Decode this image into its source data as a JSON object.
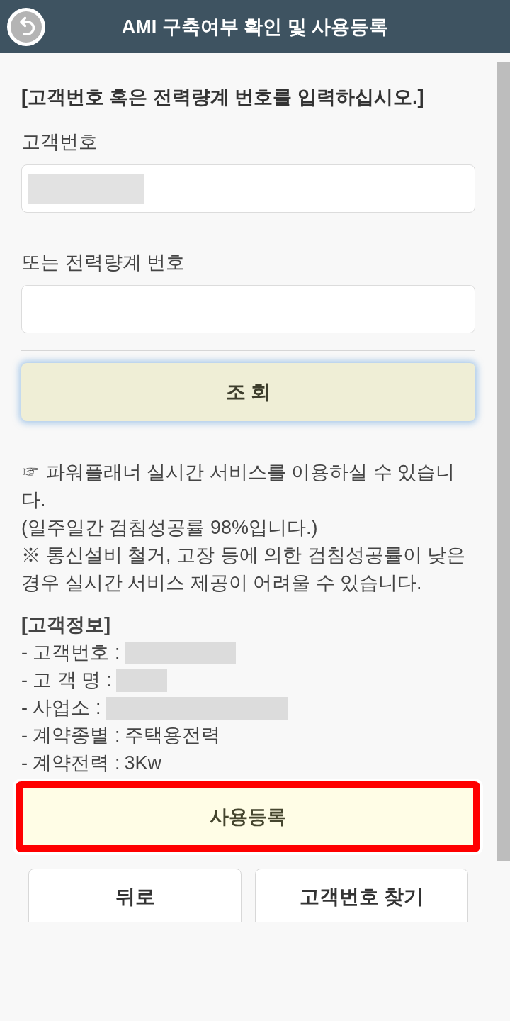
{
  "header": {
    "title": "AMI 구축여부 확인 및 사용등록"
  },
  "instruction": "[고객번호 혹은 전력량계 번호를 입력하십시오.]",
  "fields": [
    {
      "label": "고객번호",
      "value_redacted": true
    },
    {
      "label": "또는 전력량계 번호",
      "value_redacted": false
    }
  ],
  "search_button": {
    "label": "조 회"
  },
  "notices": [
    "☞ 파워플래너 실시간 서비스를 이용하실 수 있습니다.",
    "(일주일간 검침성공률 98%입니다.)",
    "※ 통신설비 철거, 고장 등에 의한 검침성공률이 낮은 경우 실시간 서비스 제공이 어려울 수 있습니다."
  ],
  "customer_info": {
    "title": "[고객정보]",
    "items": [
      {
        "label": "- 고객번호 :",
        "redacted": true
      },
      {
        "label": "- 고 객 명 :",
        "redacted": true
      },
      {
        "label": "- 사업소 :",
        "redacted": true
      },
      {
        "label": "- 계약종별 :",
        "value": "주택용전력",
        "redacted": false
      },
      {
        "label": "- 계약전력 :",
        "value": "3Kw",
        "redacted": false
      }
    ]
  },
  "register_button": {
    "label": "사용등록",
    "highlighted": true
  },
  "bottom_buttons": [
    {
      "label": "뒤로"
    },
    {
      "label": "고객번호 찾기"
    }
  ]
}
